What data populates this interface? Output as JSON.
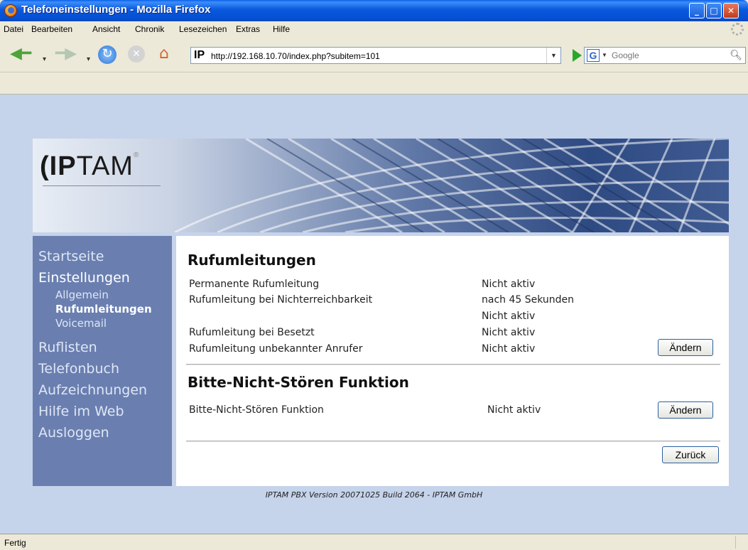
{
  "window": {
    "title": "Telefoneinstellungen - Mozilla Firefox"
  },
  "menu": [
    "Datei",
    "Bearbeiten",
    "Ansicht",
    "Chronik",
    "Lesezeichen",
    "Extras",
    "Hilfe"
  ],
  "toolbar": {
    "url": "http://192.168.10.70/index.php?subitem=101",
    "url_favicon_text": "IP",
    "search_engine_letter": "G",
    "search_placeholder": "Google"
  },
  "header": {
    "logo_text": "IPTAM",
    "logo_bold_part": "IP"
  },
  "sidebar": {
    "items": [
      {
        "label": "Startseite",
        "active": false
      },
      {
        "label": "Einstellungen",
        "active": true
      },
      {
        "label": "Allgemein",
        "sub": true,
        "active": false
      },
      {
        "label": "Rufumleitungen",
        "sub": true,
        "active": true
      },
      {
        "label": "Voicemail",
        "sub": true,
        "active": false
      },
      {
        "label": "Ruflisten",
        "active": false
      },
      {
        "label": "Telefonbuch",
        "active": false
      },
      {
        "label": "Aufzeichnungen",
        "active": false
      },
      {
        "label": "Hilfe im Web",
        "active": false
      },
      {
        "label": "Ausloggen",
        "active": false
      }
    ]
  },
  "content": {
    "section1": {
      "title": "Rufumleitungen",
      "rows": [
        {
          "label": "Permanente Rufumleitung",
          "value": "Nicht aktiv"
        },
        {
          "label": "Rufumleitung bei Nichterreichbarkeit",
          "value": "nach 45 Sekunden"
        },
        {
          "label": "",
          "value": "Nicht aktiv"
        },
        {
          "label": "Rufumleitung bei Besetzt",
          "value": "Nicht aktiv"
        },
        {
          "label": "Rufumleitung unbekannter Anrufer",
          "value": "Nicht aktiv"
        }
      ],
      "button": "Ändern"
    },
    "section2": {
      "title": "Bitte-Nicht-Stören Funktion",
      "rows": [
        {
          "label": "Bitte-Nicht-Stören Funktion",
          "value": "Nicht aktiv"
        }
      ],
      "button": "Ändern"
    },
    "back_button": "Zurück"
  },
  "footer": "IPTAM PBX Version 20071025 Build 2064 - IPTAM GmbH",
  "status": "Fertig"
}
